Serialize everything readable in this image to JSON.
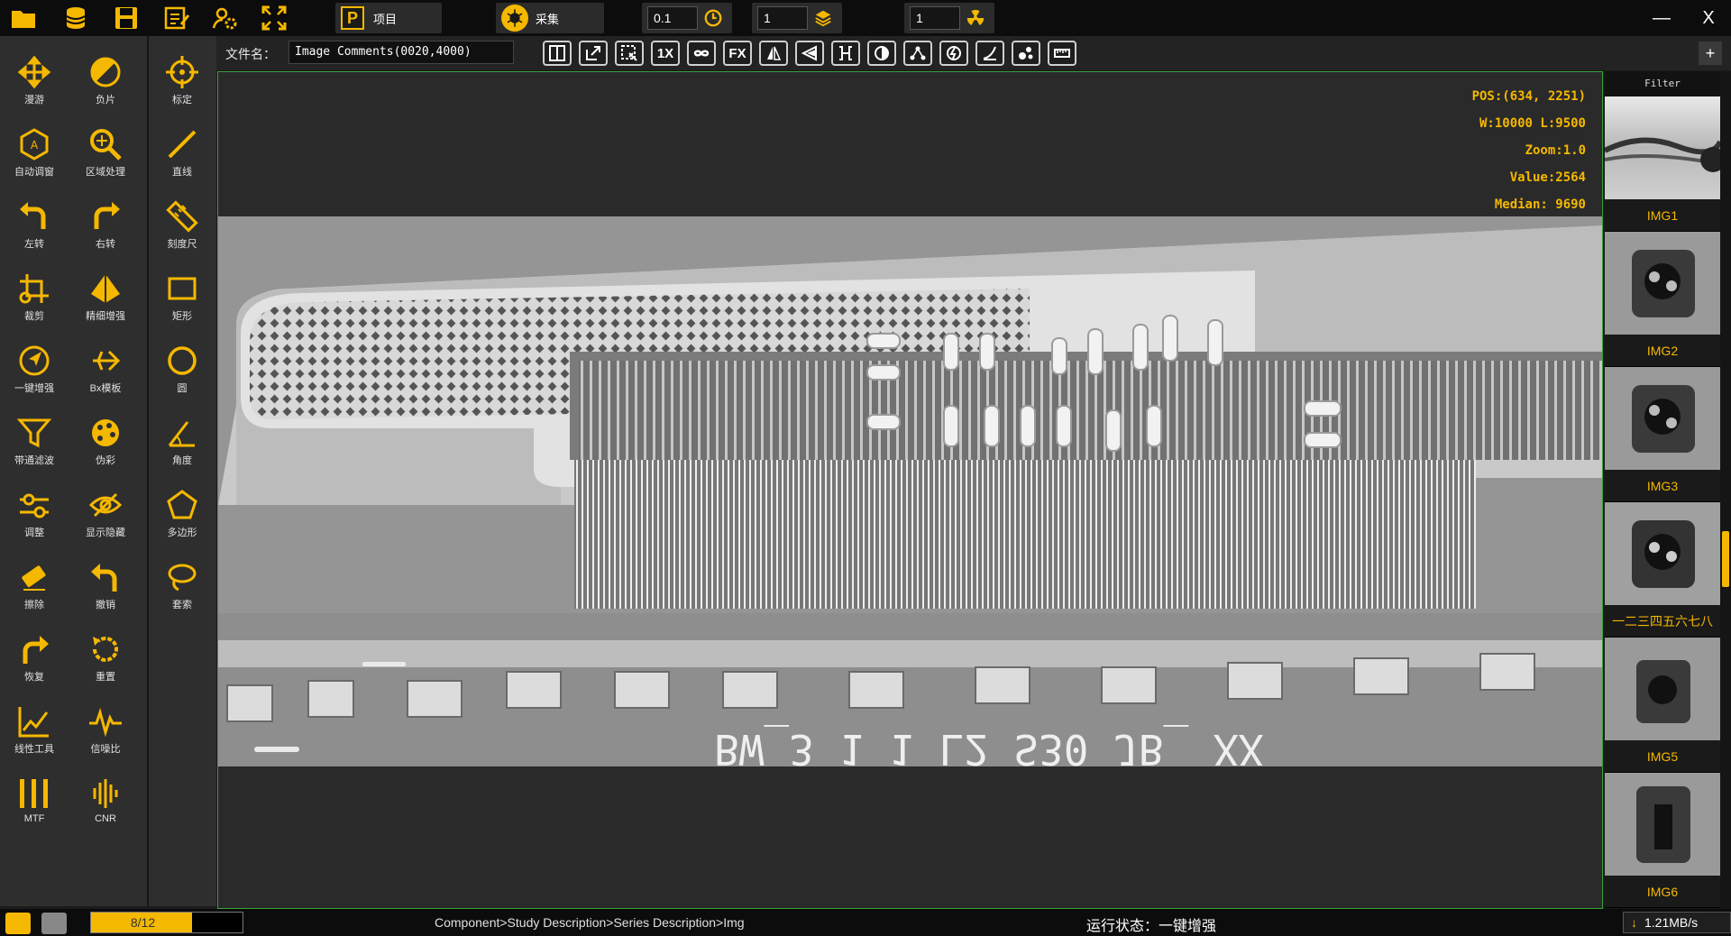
{
  "topbar": {
    "icons": [
      "folder-icon",
      "database-icon",
      "save-icon",
      "edit-icon",
      "settings-user-icon",
      "fullscreen-icon"
    ],
    "tab_project_badge": "P",
    "tab_project_label": "项目",
    "tab_acquire_label": "采集",
    "spin1_value": "0.1",
    "spin2_value": "1",
    "spin3_value": "1",
    "minimize": "—",
    "close": "X"
  },
  "tools": {
    "pan": "漫游",
    "negative": "负片",
    "calibrate": "标定",
    "auto_window": "自动调窗",
    "region_process": "区域处理",
    "line": "直线",
    "rotate_left": "左转",
    "rotate_right": "右转",
    "ruler": "刻度尺",
    "crop": "裁剪",
    "fine_enhance": "精细增强",
    "rectangle": "矩形",
    "one_click_enhance": "一键增强",
    "bx_template": "Bx模板",
    "circle": "圆",
    "bandpass": "带通滤波",
    "pseudo_color": "伪彩",
    "angle": "角度",
    "adjust": "调整",
    "show_hide": "显示隐藏",
    "polygon": "多边形",
    "erase": "擦除",
    "undo": "撤销",
    "lasso": "套索",
    "redo": "恢复",
    "reset": "重置",
    "linearity": "线性工具",
    "snr": "信噪比",
    "mtf": "MTF",
    "cnr": "CNR"
  },
  "subbar": {
    "file_label": "文件名：",
    "file_value": "Image Comments(0020,4000)",
    "buttons": [
      "1X",
      "FX"
    ]
  },
  "overlay": {
    "pos": "POS:(634, 2251)",
    "wl": "W:10000  L:9500",
    "zoom": "Zoom:1.0",
    "value": "Value:2564",
    "median": "Median: 9690"
  },
  "xray_text": "BW_3 1 1 L2 S30 JB_ XX",
  "right_panel": {
    "filter": "Filter",
    "thumbs": [
      "IMG1",
      "IMG2",
      "IMG3",
      "一二三四五六七八",
      "IMG5",
      "IMG6"
    ]
  },
  "status": {
    "progress_text": "8/12",
    "progress": 0.667,
    "breadcrumb": "Component>Study Description>Series Description>Img",
    "run_state": "运行状态：一键增强",
    "speed": "1.21MB/s"
  },
  "colors": {
    "accent": "#f5b800",
    "viewer_border": "#39a039"
  }
}
